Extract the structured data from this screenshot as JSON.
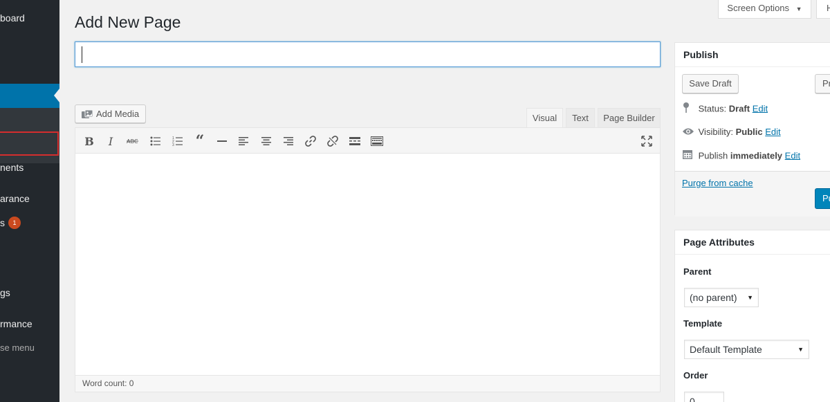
{
  "sidebar": {
    "items": [
      {
        "label": "board"
      },
      {
        "label": "nents"
      },
      {
        "label": "arance"
      },
      {
        "label": "s",
        "badge": "1"
      },
      {
        "label": "gs"
      },
      {
        "label": "rmance"
      },
      {
        "label": "se menu"
      }
    ]
  },
  "header": {
    "screen_options": "Screen Options",
    "screen_options_arrow": "▼",
    "help": "H"
  },
  "page_title": "Add New Page",
  "title_input": {
    "value": "",
    "placeholder": ""
  },
  "editor": {
    "add_media": "Add Media",
    "tabs": [
      {
        "label": "Visual",
        "active": true
      },
      {
        "label": "Text",
        "active": false
      },
      {
        "label": "Page Builder",
        "active": false
      }
    ],
    "word_count": "Word count: 0"
  },
  "publish": {
    "title": "Publish",
    "save_draft": "Save Draft",
    "preview": "Pr",
    "status_label": "Status:",
    "status_value": "Draft",
    "visibility_label": "Visibility:",
    "visibility_value": "Public",
    "publish_label": "Publish",
    "publish_value": "immediately",
    "edit": "Edit",
    "purge": "Purge from cache",
    "publish_button": "Pu"
  },
  "attributes": {
    "title": "Page Attributes",
    "parent_label": "Parent",
    "parent_value": "(no parent)",
    "template_label": "Template",
    "template_value": "Default Template",
    "order_label": "Order",
    "order_value": "0"
  },
  "colors": {
    "accent": "#0073aa",
    "sidebar": "#23282d",
    "highlight": "#d52d2d",
    "publish_button": "#0085ba"
  }
}
